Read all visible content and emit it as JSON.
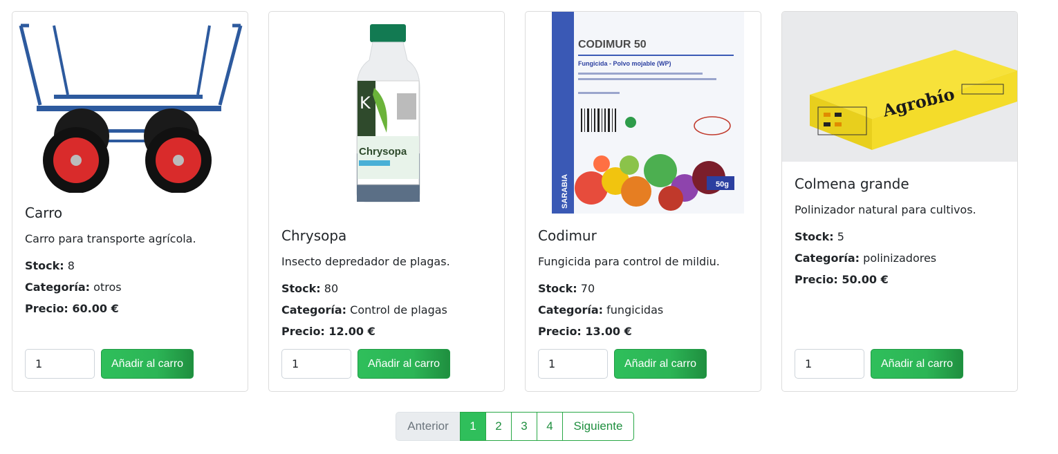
{
  "products": [
    {
      "title": "Carro",
      "description": "Carro para transporte agrícola.",
      "stock_label": "Stock:",
      "stock": "8",
      "category_label": "Categoría:",
      "category": "otros",
      "price_label": "Precio:",
      "price": "60.00 €",
      "qty": "1",
      "add_label": "Añadir al carro"
    },
    {
      "title": "Chrysopa",
      "description": "Insecto depredador de plagas.",
      "stock_label": "Stock:",
      "stock": "80",
      "category_label": "Categoría:",
      "category": "Control de plagas",
      "price_label": "Precio:",
      "price": "12.00 €",
      "qty": "1",
      "add_label": "Añadir al carro",
      "image_brand": "Chrysopa",
      "image_logo": "K"
    },
    {
      "title": "Codimur",
      "description": "Fungicida para control de mildiu.",
      "stock_label": "Stock:",
      "stock": "70",
      "category_label": "Categoría:",
      "category": "fungicidas",
      "price_label": "Precio:",
      "price": "13.00 €",
      "qty": "1",
      "add_label": "Añadir al carro",
      "image_heading": "CODIMUR 50",
      "image_subheading": "Fungicida - Polvo mojable (WP)",
      "image_side": "SARABIA",
      "image_weight": "50g"
    },
    {
      "title": "Colmena grande",
      "description": "Polinizador natural para cultivos.",
      "stock_label": "Stock:",
      "stock": "5",
      "category_label": "Categoría:",
      "category": "polinizadores",
      "price_label": "Precio:",
      "price": "50.00 €",
      "qty": "1",
      "add_label": "Añadir al carro",
      "image_brand": "Agrobío"
    }
  ],
  "pagination": {
    "prev": "Anterior",
    "pages": [
      "1",
      "2",
      "3",
      "4"
    ],
    "active": "1",
    "next": "Siguiente"
  },
  "colors": {
    "primary": "#2fbf5b",
    "border": "#dcdcdc"
  }
}
